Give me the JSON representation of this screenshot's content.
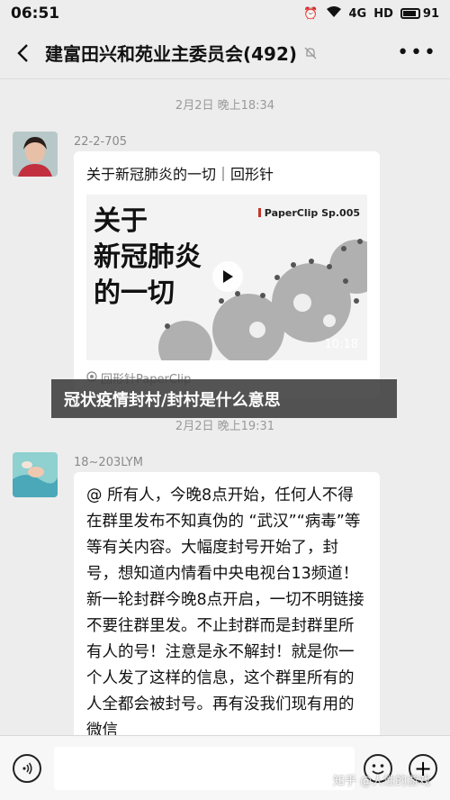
{
  "status_bar": {
    "time": "06:51",
    "network": "4G",
    "hd": "HD",
    "battery": "91"
  },
  "header": {
    "title": "建富田兴和苑业主委员会(492)"
  },
  "messages": [
    {
      "timestamp": "2月2日 晚上18:34",
      "sender": "22-2-705",
      "card": {
        "title": "关于新冠肺炎的一切｜回形针",
        "headline": "关于\n新冠肺炎\n的一切",
        "brand": "PaperClip Sp.005",
        "duration": "10:18",
        "source": "回形针PaperClip"
      }
    },
    {
      "timestamp": "2月2日 晚上19:31",
      "sender": "18~203LYM",
      "text": "@ 所有人，今晚8点开始，任何人不得在群里发布不知真伪的 “武汉”“病毒”等等有关内容。大幅度封号开始了，封号，想知道内情看中央电视台13频道！新一轮封群今晚8点开启，一切不明链接不要往群里发。不止封群而是封群里所有人的号！注意是永不解封！就是你一个人发了这样的信息，这个群里所有的人全都会被封号。再有没我们现有用的微信"
    }
  ],
  "banner": {
    "text": "冠状疫情封村/封村是什么意思"
  },
  "watermark": "知乎 @人性的游戏"
}
